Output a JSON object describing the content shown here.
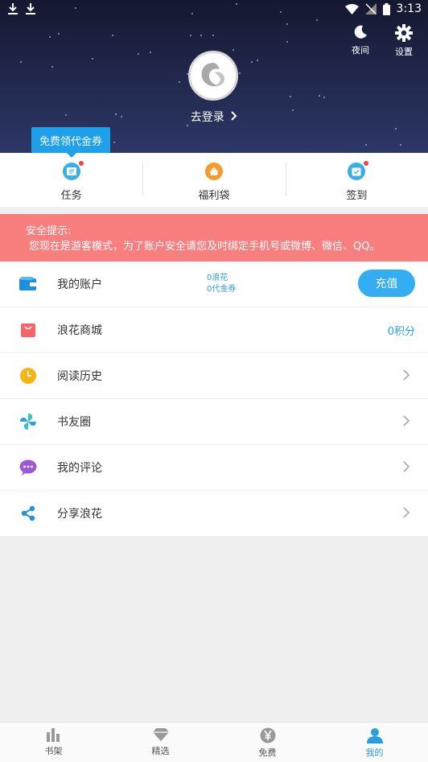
{
  "status_bar": {
    "time": "3:13"
  },
  "header": {
    "night_label": "夜间",
    "settings_label": "设置",
    "login_label": "去登录"
  },
  "promo_tip": "免费领代金券",
  "quick_actions": [
    {
      "label": "任务",
      "icon": "task-icon",
      "badge": true
    },
    {
      "label": "福利袋",
      "icon": "gift-bag-icon",
      "badge": false
    },
    {
      "label": "签到",
      "icon": "checkin-icon",
      "badge": true
    }
  ],
  "warning": {
    "title": "安全提示:",
    "message": "您现在是游客模式，为了账户安全请您及时绑定手机号或微博、微信、QQ。"
  },
  "menu": {
    "account": {
      "label": "我的账户",
      "langhua": "0浪花",
      "voucher": "0代金券",
      "recharge": "充值"
    },
    "mall": {
      "label": "浪花商城",
      "points": "0积分"
    },
    "history": {
      "label": "阅读历史"
    },
    "circle": {
      "label": "书友圈"
    },
    "comments": {
      "label": "我的评论"
    },
    "share": {
      "label": "分享浪花"
    }
  },
  "tabbar": [
    {
      "label": "书架",
      "icon": "bookshelf-icon",
      "active": false
    },
    {
      "label": "精选",
      "icon": "diamond-icon",
      "active": false
    },
    {
      "label": "免费",
      "icon": "yen-icon",
      "active": false
    },
    {
      "label": "我的",
      "icon": "user-icon",
      "active": true
    }
  ],
  "colors": {
    "accent": "#33aef2",
    "warning_bg": "#f97f7f",
    "header_bg": "#1f2649",
    "badge": "#f2434d"
  }
}
